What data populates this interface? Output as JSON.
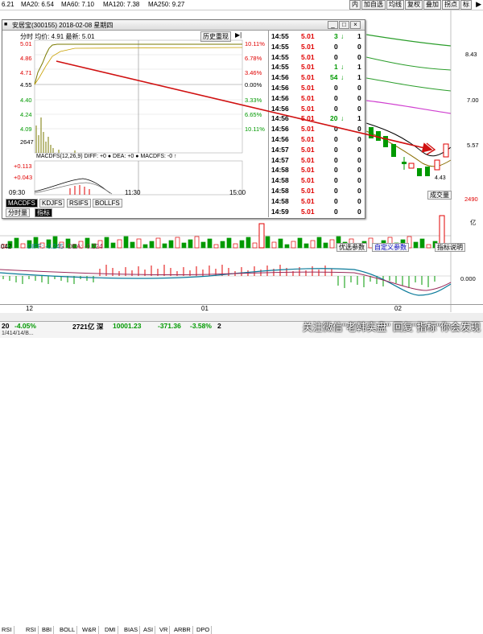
{
  "ma_bar": {
    "items": [
      {
        "label": "6.21",
        "color": "#000000"
      },
      {
        "label": "MA20: 6.54",
        "color": "#8a6d00"
      },
      {
        "label": "MA60: 7.10",
        "color": "#d040d0"
      },
      {
        "label": "MA120: 7.38",
        "color": "#2a9d2a"
      },
      {
        "label": "MA250: 9.27",
        "color": "#8a5a00"
      }
    ],
    "toolbar": [
      "内",
      "加自选",
      "均线",
      "复权",
      "叠加",
      "拐点",
      "标"
    ]
  },
  "main_chart": {
    "price_labels": [
      "8.43",
      "7.00",
      "5.57",
      "4.43"
    ],
    "volume_label": "2490",
    "volume_unit": "亿",
    "right_buttons": [
      "成交量"
    ],
    "lower_buttons": [
      "优选参数",
      "自定义参数",
      "指标说明"
    ],
    "low_marker": "4.43",
    "zero_label": "0.000"
  },
  "macd_bar": {
    "label": "042",
    "diff": "DIFF: -0.245",
    "dea": "DEA: -0.224",
    "side_label": "0.000"
  },
  "x_axis": {
    "labels": [
      "12",
      "01",
      "02"
    ]
  },
  "indicator_tabs": [
    "RSI",
    "RSI",
    "BBI",
    "BOLL",
    "W&R",
    "DMI",
    "BIAS",
    "ASI",
    "VR",
    "ARBR",
    "DPO"
  ],
  "status_bar": {
    "items": [
      {
        "text": "20",
        "color": "#000"
      },
      {
        "text": "-4.05%",
        "color": "#009900"
      },
      {
        "text": "2721亿",
        "color": "#000"
      },
      {
        "text": "深",
        "color": "#000"
      },
      {
        "text": "10001.23",
        "color": "#009900"
      },
      {
        "text": "-371.36",
        "color": "#009900"
      },
      {
        "text": "-3.58%",
        "color": "#009900"
      },
      {
        "text": "2",
        "color": "#000"
      }
    ],
    "sub_left": "1/414/14/B...",
    "watermark": "关注微信\"老韩实盘\" 回复\"指标\"你会发现"
  },
  "popup": {
    "title": "安居宝(300155) 2018-02-08 星期四",
    "history_button": "历史重现",
    "header_left": "分时 均价: 4.91 最新: 5.01",
    "left_axis": [
      "5.01",
      "4.86",
      "4.71",
      "4.55",
      "4.40",
      "4.24",
      "4.09"
    ],
    "right_axis": [
      "10.11%",
      "6.78%",
      "3.46%",
      "0.00%",
      "3.33%",
      "6.65%",
      "10.11%"
    ],
    "volume_axis": "2647",
    "macd_label": "MACDFS(12,26,9) DIFF: +0 ● DEA: +0 ● MACDFS: -0 ↑",
    "macd_axis": [
      "+0.113",
      "+0.043"
    ],
    "time_labels": [
      "09:30",
      "11:30",
      "15:00"
    ],
    "tabs": [
      "MACDFS",
      "KDJFS",
      "RSIFS",
      "BOLLFS"
    ],
    "bottom_tabs": [
      "分时量",
      "指标"
    ]
  },
  "ticks": {
    "rows": [
      {
        "time": "14:55",
        "price": "5.01",
        "volume": "3",
        "dir": "down",
        "count": "1"
      },
      {
        "time": "14:55",
        "price": "5.01",
        "volume": "0",
        "dir": "",
        "count": "0"
      },
      {
        "time": "14:55",
        "price": "5.01",
        "volume": "0",
        "dir": "",
        "count": "0"
      },
      {
        "time": "14:55",
        "price": "5.01",
        "volume": "1",
        "dir": "down",
        "count": "1"
      },
      {
        "time": "14:56",
        "price": "5.01",
        "volume": "54",
        "dir": "down",
        "count": "1"
      },
      {
        "time": "14:56",
        "price": "5.01",
        "volume": "0",
        "dir": "",
        "count": "0"
      },
      {
        "time": "14:56",
        "price": "5.01",
        "volume": "0",
        "dir": "",
        "count": "0"
      },
      {
        "time": "14:56",
        "price": "5.01",
        "volume": "0",
        "dir": "",
        "count": "0"
      },
      {
        "time": "14:56",
        "price": "5.01",
        "volume": "20",
        "dir": "down",
        "count": "1"
      },
      {
        "time": "14:56",
        "price": "5.01",
        "volume": "0",
        "dir": "",
        "count": "0"
      },
      {
        "time": "14:56",
        "price": "5.01",
        "volume": "0",
        "dir": "",
        "count": "0"
      },
      {
        "time": "14:57",
        "price": "5.01",
        "volume": "0",
        "dir": "",
        "count": "0"
      },
      {
        "time": "14:57",
        "price": "5.01",
        "volume": "0",
        "dir": "",
        "count": "0"
      },
      {
        "time": "14:58",
        "price": "5.01",
        "volume": "0",
        "dir": "",
        "count": "0"
      },
      {
        "time": "14:58",
        "price": "5.01",
        "volume": "0",
        "dir": "",
        "count": "0"
      },
      {
        "time": "14:58",
        "price": "5.01",
        "volume": "0",
        "dir": "",
        "count": "0"
      },
      {
        "time": "14:58",
        "price": "5.01",
        "volume": "0",
        "dir": "",
        "count": "0"
      },
      {
        "time": "14:59",
        "price": "5.01",
        "volume": "0",
        "dir": "",
        "count": "0"
      }
    ]
  },
  "colors": {
    "up": "#e00000",
    "down": "#009900",
    "arrow": "#d01010"
  }
}
